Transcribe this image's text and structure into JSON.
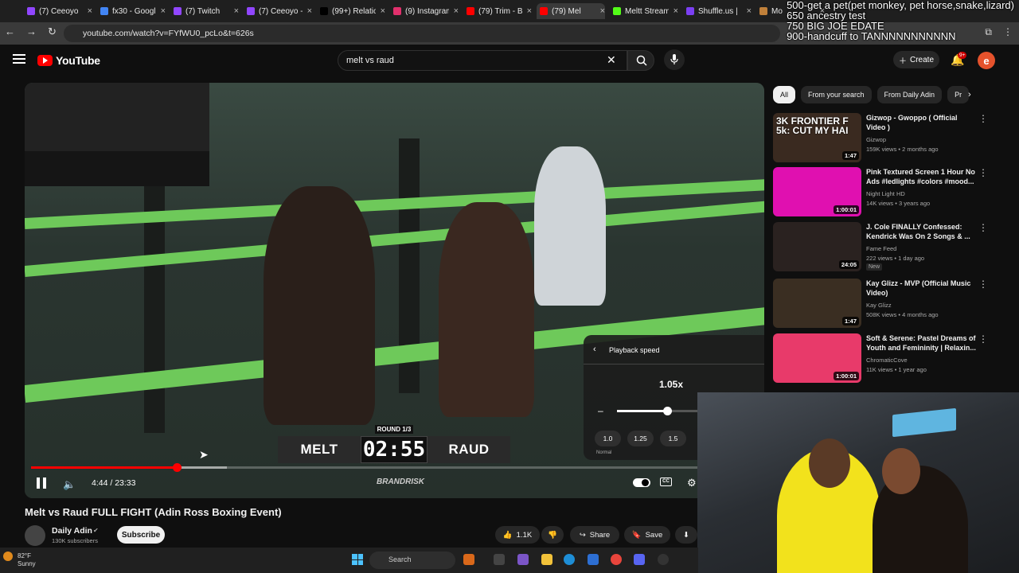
{
  "browser": {
    "tabs": [
      {
        "label": "(7) Ceeoyo",
        "color": "#9146ff"
      },
      {
        "label": "fx30 - Googl",
        "color": "#4285f4"
      },
      {
        "label": "(7) Twitch",
        "color": "#9146ff"
      },
      {
        "label": "(7) Ceeoyo -",
        "color": "#9146ff"
      },
      {
        "label": "(99+) Relatio",
        "color": "#000000"
      },
      {
        "label": "(9) Instagram",
        "color": "#e1306c"
      },
      {
        "label": "(79) Trim - B",
        "color": "#ff0000"
      },
      {
        "label": "(79) Mel",
        "color": "#ff0000"
      },
      {
        "label": "Meltt Stream",
        "color": "#53fc18"
      },
      {
        "label": "Shuffle.us |",
        "color": "#7b3ff2"
      },
      {
        "label": "Mo",
        "color": "#c0803a"
      }
    ],
    "url": "youtube.com/watch?v=FYfWU0_pcLo&t=626s"
  },
  "overlay_lines": [
    "500-get a pet(pet monkey, pet horse,snake,lizard)",
    "650 ancestry test",
    "750 BIG JOE EDATE",
    "900-handcuff to TANNNNNNNNNNN"
  ],
  "youtube": {
    "logo_text": "YouTube",
    "search_value": "melt vs raud",
    "create_label": "Create",
    "notif_badge": "9+",
    "avatar_letter": "e"
  },
  "player": {
    "time": "4:44 / 23:33",
    "progress_fraction": 0.201,
    "loaded_fraction": 0.27,
    "scoreboard": {
      "left": "MELT",
      "clock": "02:55",
      "right": "RAUD",
      "round": "ROUND 1/3"
    },
    "brand": "BRANDRISK",
    "playback_speed": {
      "title": "Playback speed",
      "value": "1.05x",
      "fraction": 0.35,
      "presets": [
        "1.0",
        "1.25",
        "1.5"
      ],
      "normal_label": "Normal"
    }
  },
  "video": {
    "title": "Melt vs Raud FULL FIGHT (Adin Ross Boxing Event)",
    "channel": "Daily Adin",
    "subscribers": "130K subscribers",
    "subscribe_label": "Subscribe",
    "likes": "1.1K",
    "share_label": "Share",
    "save_label": "Save"
  },
  "sidebar": {
    "chips": [
      "All",
      "From your search",
      "From Daily Adin",
      "Pr"
    ],
    "recommendations": [
      {
        "title": "Gizwop - Gwoppo ( Official Video )",
        "channel": "Gizwop",
        "meta": "159K views • 2 months ago",
        "duration": "1:47",
        "thumb_color": "#3a2a20",
        "thumb_text": "3K FRONTIER F\n5k: CUT MY HAI",
        "badge": ""
      },
      {
        "title": "Pink Textured Screen 1 Hour No Ads #ledlights #colors #mood...",
        "channel": "Night Light HD",
        "meta": "14K views • 3 years ago",
        "duration": "1:00:01",
        "thumb_color": "#e010b0",
        "thumb_text": "",
        "badge": ""
      },
      {
        "title": "J. Cole FINALLY Confessed: Kendrick Was On 2 Songs & ...",
        "channel": "Fame Feed",
        "meta": "222 views • 1 day ago",
        "duration": "24:05",
        "thumb_color": "#2a2220",
        "thumb_text": "",
        "badge": "New"
      },
      {
        "title": "Kay Glizz - MVP (Official Music Video)",
        "channel": "Kay Glizz",
        "meta": "508K views • 4 months ago",
        "duration": "1:47",
        "thumb_color": "#3a2e22",
        "thumb_text": "",
        "badge": ""
      },
      {
        "title": "Soft & Serene: Pastel Dreams of Youth and Femininity | Relaxin...",
        "channel": "ChromaticCove",
        "meta": "11K views • 1 year ago",
        "duration": "1:00:01",
        "thumb_color": "#e83a6a",
        "thumb_text": "",
        "badge": ""
      }
    ]
  },
  "taskbar": {
    "weather_temp": "82°F",
    "weather_desc": "Sunny",
    "search_placeholder": "Search"
  },
  "colors": {
    "accent_red": "#ff0000",
    "ring_rope": "#6ec95a",
    "webcam_hoodie": "#f2e21c"
  }
}
